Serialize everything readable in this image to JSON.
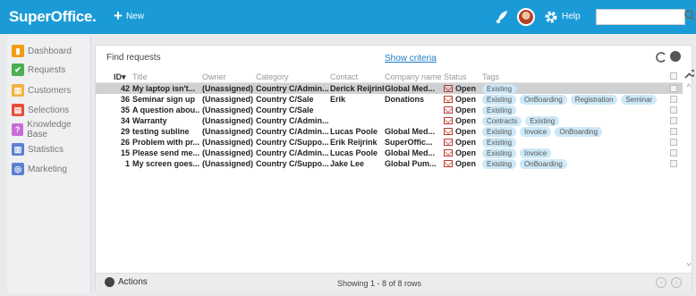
{
  "app": {
    "logo": "SuperOffice.",
    "new_label": "New",
    "help_label": "Help",
    "search_value": ""
  },
  "sidebar": {
    "items": [
      {
        "label": "Dashboard",
        "icon": "dashboard-icon",
        "color": "#f39c12"
      },
      {
        "label": "Requests",
        "icon": "requests-icon",
        "color": "#4caf50"
      },
      {
        "label": "Customers",
        "icon": "customers-icon",
        "color": "#f5b041"
      },
      {
        "label": "Selections",
        "icon": "selections-icon",
        "color": "#e74c3c"
      },
      {
        "label": "Knowledge Base",
        "icon": "knowledge-base-icon",
        "color": "#c86dd7"
      },
      {
        "label": "Statistics",
        "icon": "statistics-icon",
        "color": "#5c7fd1"
      },
      {
        "label": "Marketing",
        "icon": "marketing-icon",
        "color": "#5c7fd1"
      }
    ]
  },
  "panel": {
    "title": "Find requests",
    "show_criteria": "Show criteria",
    "columns": {
      "id": "ID",
      "title": "Title",
      "owner": "Owner",
      "category": "Category",
      "contact": "Contact",
      "company": "Company name",
      "status": "Status",
      "tags": "Tags"
    },
    "rows": [
      {
        "id": "42",
        "title": "My laptop isn't...",
        "owner": "(Unassigned)",
        "category": "Country C/Admin...",
        "contact": "Derick Reijrink",
        "company": "Global Med...",
        "status": "Open",
        "tags": [
          "Existing"
        ]
      },
      {
        "id": "36",
        "title": "Seminar sign up",
        "owner": "(Unassigned)",
        "category": "Country C/Sale",
        "contact": "Erik",
        "company": "Donations",
        "status": "Open",
        "tags": [
          "Existing",
          "OnBoarding",
          "Registration",
          "Seminar"
        ]
      },
      {
        "id": "35",
        "title": "A question abou...",
        "owner": "(Unassigned)",
        "category": "Country C/Sale",
        "contact": "",
        "company": "",
        "status": "Open",
        "tags": [
          "Existing"
        ]
      },
      {
        "id": "34",
        "title": "Warranty",
        "owner": "(Unassigned)",
        "category": "Country C/Admin...",
        "contact": "",
        "company": "",
        "status": "Open",
        "tags": [
          "Contracts",
          "Existing"
        ]
      },
      {
        "id": "29",
        "title": "testing subline",
        "owner": "(Unassigned)",
        "category": "Country C/Admin...",
        "contact": "Lucas Poole",
        "company": "Global Med...",
        "status": "Open",
        "tags": [
          "Existing",
          "Invoice",
          "OnBoarding"
        ]
      },
      {
        "id": "26",
        "title": "Problem with pr...",
        "owner": "(Unassigned)",
        "category": "Country C/Suppo...",
        "contact": "Erik Reijrink",
        "company": "SuperOffic...",
        "status": "Open",
        "tags": [
          "Existing"
        ]
      },
      {
        "id": "15",
        "title": "Please send me...",
        "owner": "(Unassigned)",
        "category": "Country C/Admin...",
        "contact": "Lucas Poole",
        "company": "Global Med...",
        "status": "Open",
        "tags": [
          "Existing",
          "Invoice"
        ]
      },
      {
        "id": "1",
        "title": "My screen goes...",
        "owner": "(Unassigned)",
        "category": "Country C/Suppo...",
        "contact": "Jake Lee",
        "company": "Global Pum...",
        "status": "Open",
        "tags": [
          "Existing",
          "OnBoarding"
        ]
      }
    ],
    "footer": {
      "actions": "Actions",
      "rows_count": "Showing 1 - 8 of 8 rows"
    }
  }
}
